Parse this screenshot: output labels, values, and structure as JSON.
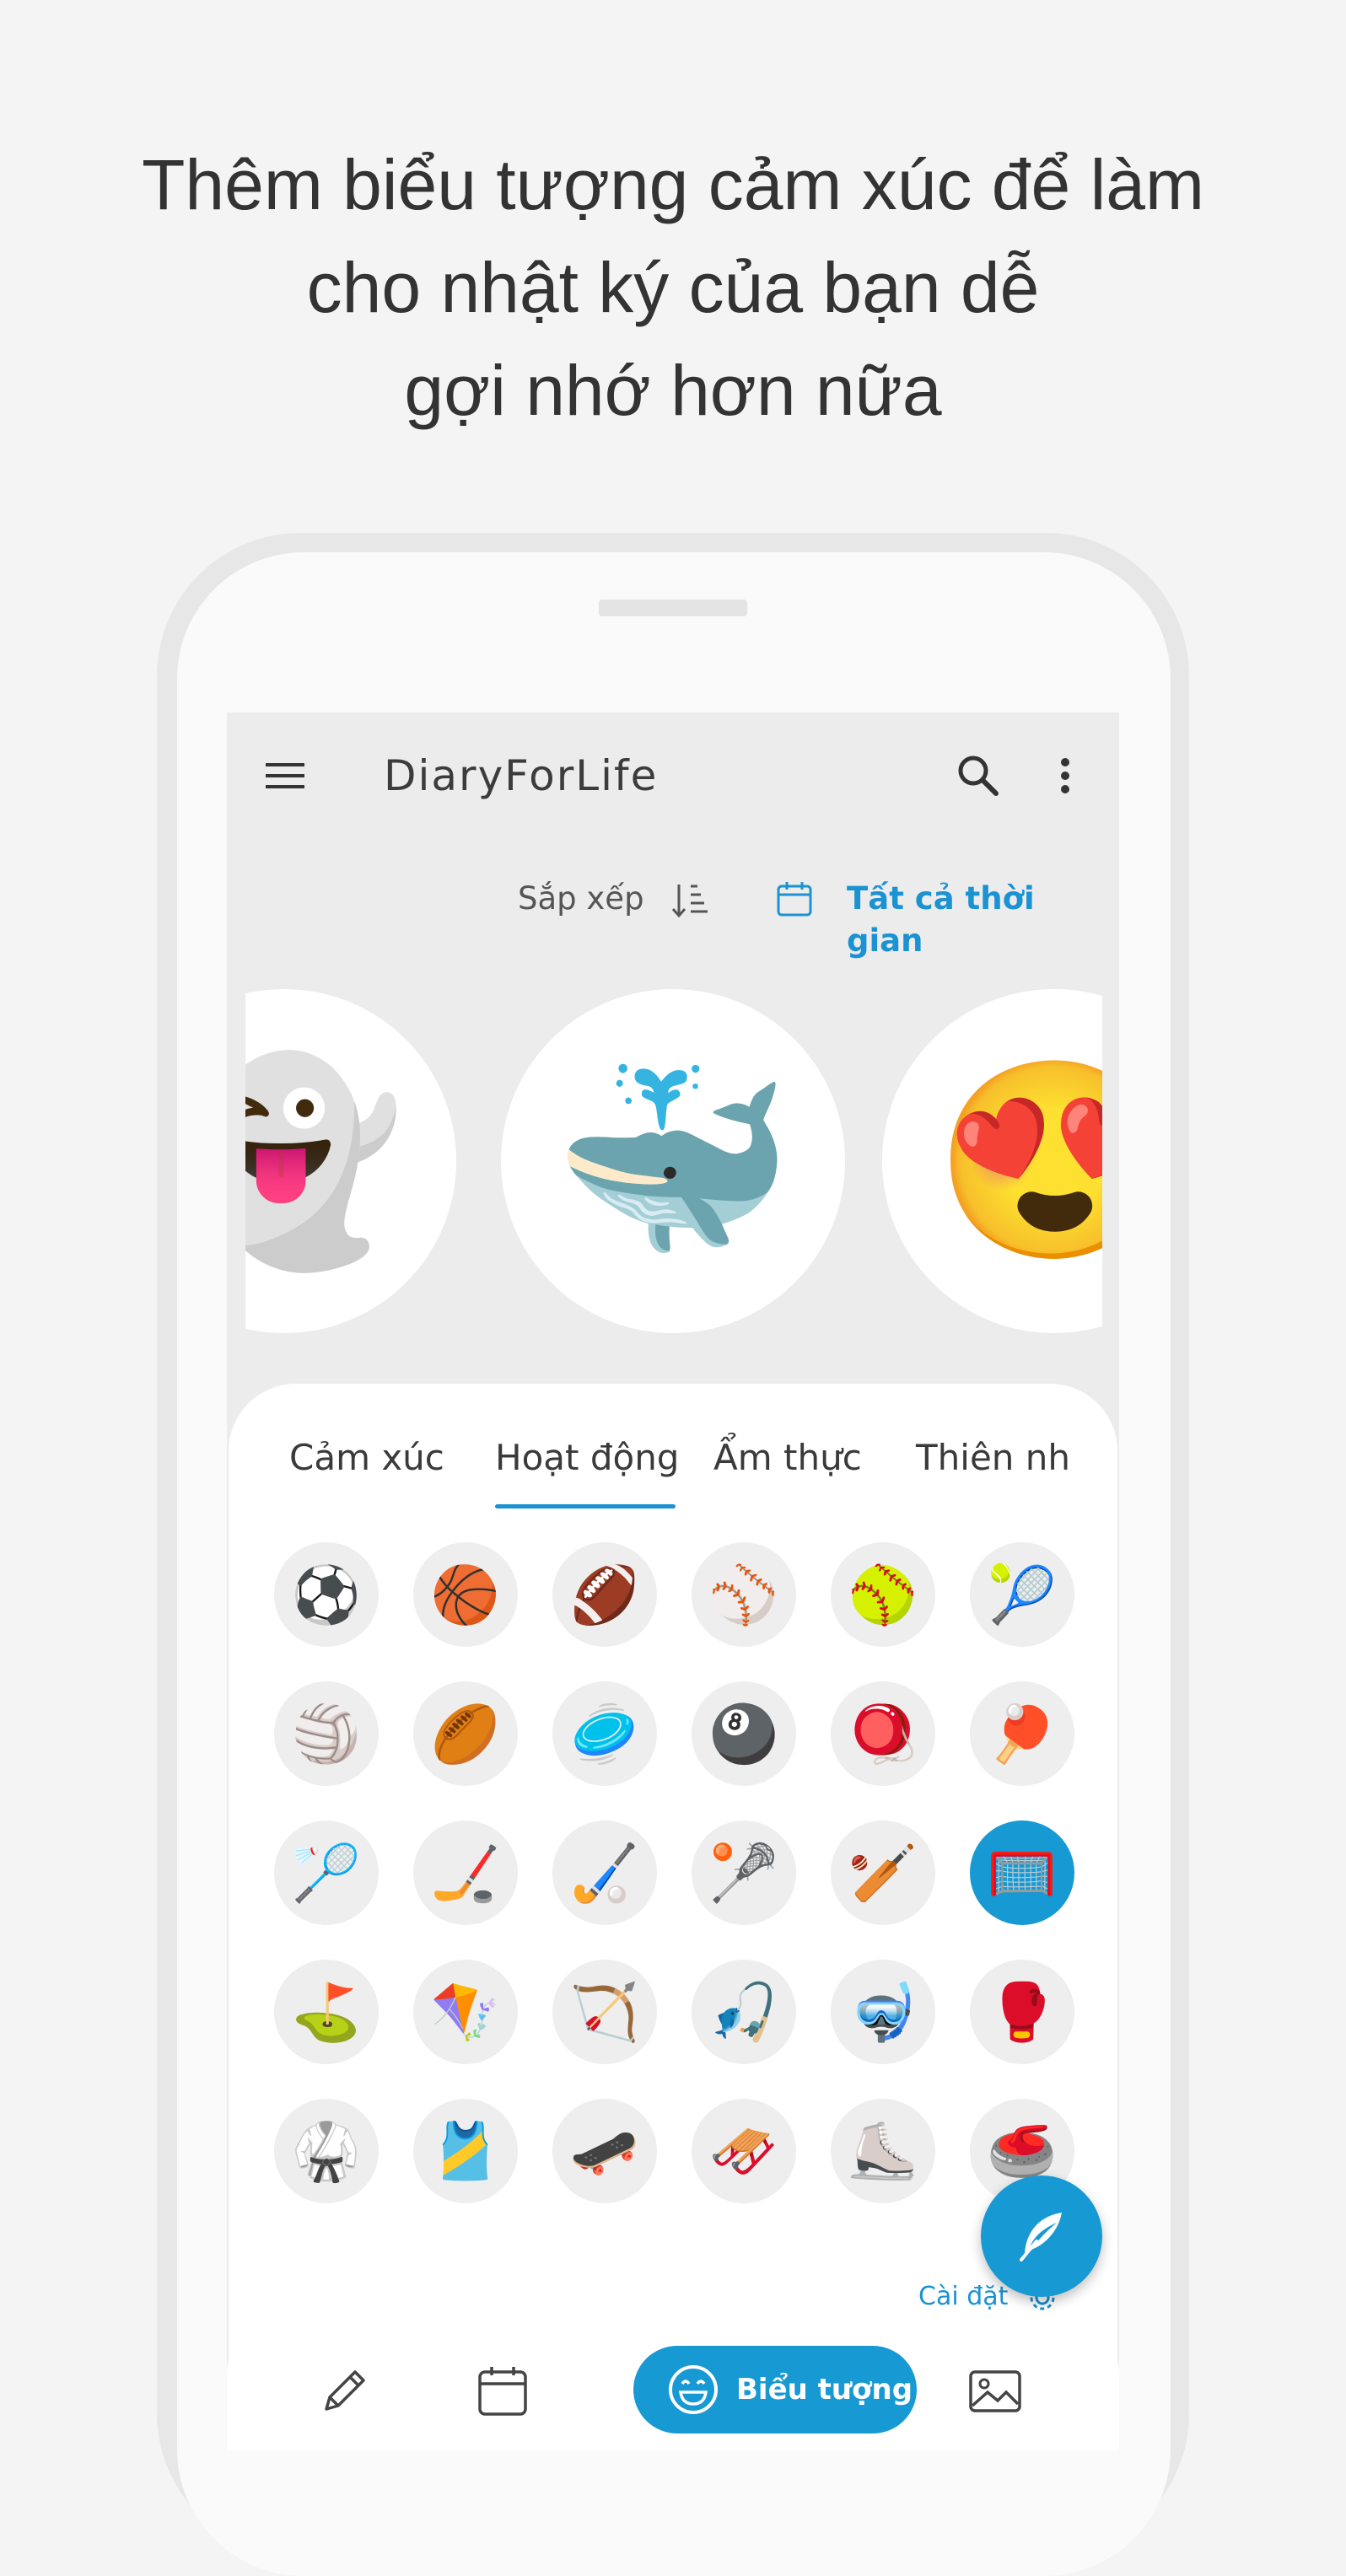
{
  "headline": {
    "line1": "Thêm biểu tượng cảm xúc để làm",
    "line2": "cho nhật ký của bạn dễ",
    "line3": "gợi nhớ hơn nữa"
  },
  "appbar": {
    "title": "DiaryForLife",
    "icons": [
      "menu-icon",
      "search-icon",
      "more-vert-icon"
    ]
  },
  "filter_bar": {
    "sort_label": "Sắp xếp",
    "time_filter": "Tất cả thời gian"
  },
  "mood_carousel": [
    "👻",
    "🐳",
    "😍"
  ],
  "sheet": {
    "tabs": [
      "Cảm xúc",
      "Hoạt động",
      "Ẩm thực",
      "Thiên nh"
    ],
    "active_tab": "Hoạt động",
    "emojis": [
      "⚽",
      "🏀",
      "🏈",
      "⚾",
      "🥎",
      "🎾",
      "🏐",
      "🏉",
      "🥏",
      "🎱",
      "🪀",
      "🏓",
      "🏸",
      "🏒",
      "🏑",
      "🥍",
      "🏏",
      "🥅",
      "⛳",
      "🪁",
      "🏹",
      "🎣",
      "🤿",
      "🥊",
      "🥋",
      "🎽",
      "🛹",
      "🛷",
      "⛸️",
      "🥌"
    ],
    "selected_emoji": "🥅",
    "settings_label": "Cài đặt"
  },
  "bottom_nav": {
    "pill_label": "Biểu tượng",
    "icons": [
      "edit-icon",
      "calendar-icon",
      "emoji-icon",
      "image-icon"
    ]
  },
  "colors": {
    "accent": "#1799d3",
    "link": "#1b92d1",
    "background": "#f4f4f4",
    "screen_bg": "#ececec"
  }
}
